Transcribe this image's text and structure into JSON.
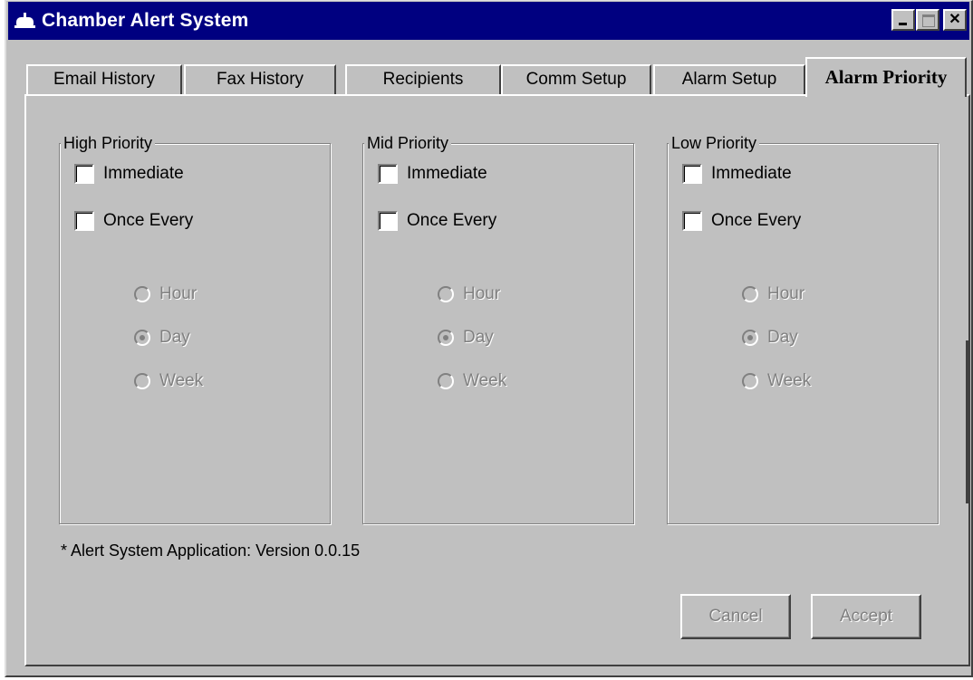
{
  "window": {
    "title": "Chamber Alert System",
    "icon": "bell-icon"
  },
  "titlebar_buttons": {
    "minimize": "_",
    "maximize": "□",
    "close": "✕"
  },
  "tabs": [
    {
      "label": "Email History",
      "active": false
    },
    {
      "label": "Fax History",
      "active": false
    },
    {
      "label": "Recipients",
      "active": false
    },
    {
      "label": "Comm Setup",
      "active": false
    },
    {
      "label": "Alarm Setup",
      "active": false
    },
    {
      "label": "Alarm Priority",
      "active": true
    }
  ],
  "groups": [
    {
      "title": "High Priority",
      "immediate_label": "Immediate",
      "immediate_checked": false,
      "once_every_label": "Once Every",
      "once_every_checked": false,
      "options": [
        {
          "label": "Hour",
          "selected": false
        },
        {
          "label": "Day",
          "selected": true
        },
        {
          "label": "Week",
          "selected": false
        }
      ]
    },
    {
      "title": "Mid Priority",
      "immediate_label": "Immediate",
      "immediate_checked": false,
      "once_every_label": "Once Every",
      "once_every_checked": false,
      "options": [
        {
          "label": "Hour",
          "selected": false
        },
        {
          "label": "Day",
          "selected": true
        },
        {
          "label": "Week",
          "selected": false
        }
      ]
    },
    {
      "title": "Low Priority",
      "immediate_label": "Immediate",
      "immediate_checked": false,
      "once_every_label": "Once Every",
      "once_every_checked": false,
      "options": [
        {
          "label": "Hour",
          "selected": false
        },
        {
          "label": "Day",
          "selected": true
        },
        {
          "label": "Week",
          "selected": false
        }
      ]
    }
  ],
  "footer": {
    "version_text": "* Alert System Application: Version 0.0.15",
    "cancel_label": "Cancel",
    "accept_label": "Accept"
  },
  "colors": {
    "titlebar": "#000080",
    "face": "#c0c0c0",
    "disabled_text": "#808080"
  }
}
